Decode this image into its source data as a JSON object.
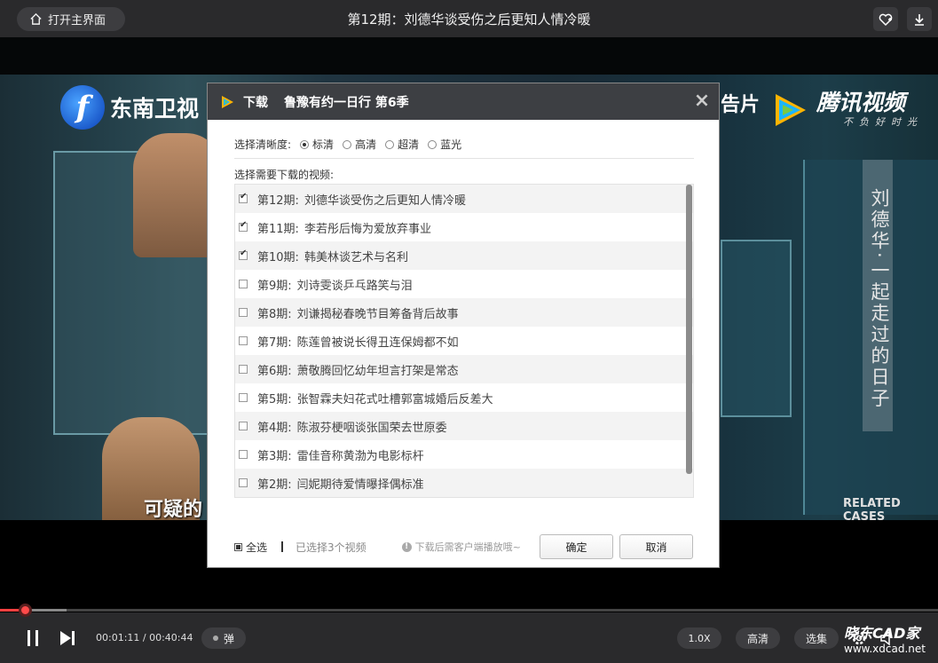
{
  "topbar": {
    "home_label": "打开主界面",
    "title": "第12期：刘德华谈受伤之后更知人情冷暖",
    "icons": [
      "home-icon",
      "favorite-add-icon",
      "download-icon"
    ]
  },
  "video": {
    "left_logo_letter": "f",
    "left_logo": "东南卫视",
    "right_logo": "腾讯视频",
    "right_logo_tagline": "不负好时光",
    "partial_text": "告片",
    "vertical_caption": "刘德华·一起走过的日子",
    "related_cases": "RELATED CASES",
    "subtitle": "可疑的"
  },
  "dialog": {
    "title_label": "下载",
    "show_title": "鲁豫有约一日行 第6季",
    "quality_label": "选择清晰度:",
    "quality_options": [
      {
        "label": "标清",
        "selected": true
      },
      {
        "label": "高清",
        "selected": false
      },
      {
        "label": "超清",
        "selected": false
      },
      {
        "label": "蓝光",
        "selected": false
      }
    ],
    "choose_label": "选择需要下载的视频:",
    "episodes": [
      {
        "ep": "第12期:",
        "title": "刘德华谈受伤之后更知人情冷暖",
        "checked": true
      },
      {
        "ep": "第11期:",
        "title": "李若彤后悔为爱放弃事业",
        "checked": true
      },
      {
        "ep": "第10期:",
        "title": "韩美林谈艺术与名利",
        "checked": true
      },
      {
        "ep": "第9期:",
        "title": "刘诗雯谈乒乓路笑与泪",
        "checked": false
      },
      {
        "ep": "第8期:",
        "title": "刘谦揭秘春晚节目筹备背后故事",
        "checked": false
      },
      {
        "ep": "第7期:",
        "title": "陈莲曾被说长得丑连保姆都不如",
        "checked": false
      },
      {
        "ep": "第6期:",
        "title": "萧敬腾回忆幼年坦言打架是常态",
        "checked": false
      },
      {
        "ep": "第5期:",
        "title": "张智霖夫妇花式吐槽郭富城婚后反差大",
        "checked": false
      },
      {
        "ep": "第4期:",
        "title": "陈淑芬梗咽谈张国荣去世原委",
        "checked": false
      },
      {
        "ep": "第3期:",
        "title": "雷佳音称黄渤为电影标杆",
        "checked": false
      },
      {
        "ep": "第2期:",
        "title": "闫妮期待爱情曝择偶标准",
        "checked": false
      }
    ],
    "select_all_label": "全选",
    "selected_count": "已选择3个视频",
    "note": "下载后需客户端播放哦~",
    "ok_label": "确定",
    "cancel_label": "取消",
    "close_symbol": "×"
  },
  "player": {
    "progress": 0.0276,
    "time": "00:01:11 / 00:40:44",
    "danmu_label": "弹",
    "speed_label": "1.0X",
    "quality_label": "高清",
    "episodes_label": "选集",
    "watermark": "晓东CAD家",
    "watermark_url": "www.xdcad.net"
  },
  "colors": {
    "accent_red": "#ff4040",
    "bar_bg": "#2a2a2c",
    "dialog_header": "#3d3f43"
  }
}
